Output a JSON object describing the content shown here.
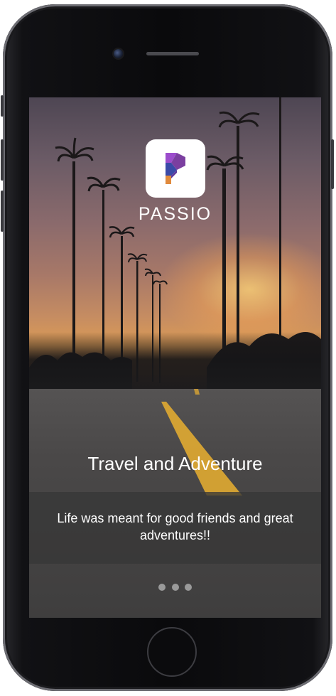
{
  "app": {
    "brand_name": "PASSIO",
    "logo_letter": "P"
  },
  "onboarding": {
    "title": "Travel and Adventure",
    "caption": "Life was meant for good friends and great adventures!!",
    "page_indicator": {
      "total_pages": 3,
      "current_page": 1
    }
  },
  "colors": {
    "logo_purple": "#7b3fa0",
    "logo_violet": "#9c4dcc",
    "logo_blue": "#3a4aa8",
    "logo_orange": "#e08a3c",
    "text": "#ffffff",
    "dot_inactive": "#9a9a9a"
  },
  "icons": [
    "front-camera-icon",
    "earpiece-speaker-icon",
    "home-button-icon",
    "passio-logo-icon"
  ]
}
